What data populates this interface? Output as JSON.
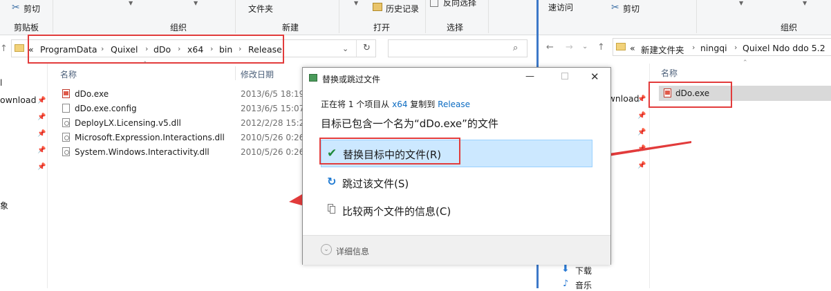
{
  "left_window": {
    "ribbon": {
      "cut_label": "剪切",
      "clipboard_group": "剪贴板",
      "organize_group": "组织",
      "folder_label": "文件夹",
      "new_group": "新建",
      "history_label": "历史记录",
      "open_group": "打开",
      "invert_label": "反向选择",
      "select_group": "选择"
    },
    "address": {
      "overflow": "«",
      "crumbs": [
        "ProgramData",
        "Quixel",
        "dDo",
        "x64",
        "bin",
        "Release"
      ]
    },
    "sidebar": {
      "download_label": "ownload",
      "image_label": "象"
    },
    "columns": {
      "name": "名称",
      "modified": "修改日期"
    },
    "files": [
      {
        "name": "dDo.exe",
        "date": "2013/6/5 18:19",
        "icon": "exe-icon"
      },
      {
        "name": "dDo.exe.config",
        "date": "2013/6/5 15:07",
        "icon": "file-icon"
      },
      {
        "name": "DeployLX.Licensing.v5.dll",
        "date": "2012/2/28 15:24",
        "icon": "dll-icon"
      },
      {
        "name": "Microsoft.Expression.Interactions.dll",
        "date": "2010/5/26 0:26",
        "icon": "dll-icon"
      },
      {
        "name": "System.Windows.Interactivity.dll",
        "date": "2010/5/26 0:26",
        "icon": "dll-icon"
      }
    ]
  },
  "right_window": {
    "ribbon": {
      "quick_access": "速访问",
      "cut_label": "剪切",
      "organize_group": "组织"
    },
    "address": {
      "overflow": "«",
      "crumbs": [
        "新建文件夹",
        "ningqi",
        "Quixel Ndo ddo 5.2"
      ]
    },
    "sidebar": {
      "download_label": "ownload",
      "downloads_label": "下载",
      "music_label": "音乐"
    },
    "columns": {
      "name": "名称"
    },
    "files": [
      {
        "name": "dDo.exe",
        "icon": "exe-icon"
      }
    ]
  },
  "dialog": {
    "title": "替换或跳过文件",
    "copy_prefix": "正在将 1 个项目从",
    "source": "x64",
    "copy_middle": "复制到",
    "destination": "Release",
    "headline": "目标已包含一个名为“dDo.exe”的文件",
    "options": [
      {
        "label": "替换目标中的文件(R)",
        "icon": "checkmark-icon"
      },
      {
        "label": "跳过该文件(S)",
        "icon": "skip-icon"
      },
      {
        "label": "比较两个文件的信息(C)",
        "icon": "compare-icon"
      }
    ],
    "details_label": "详细信息",
    "accent": "#0b6bc2",
    "selected_bg": "#cce8ff"
  },
  "annotation_color": "#e23b3b"
}
